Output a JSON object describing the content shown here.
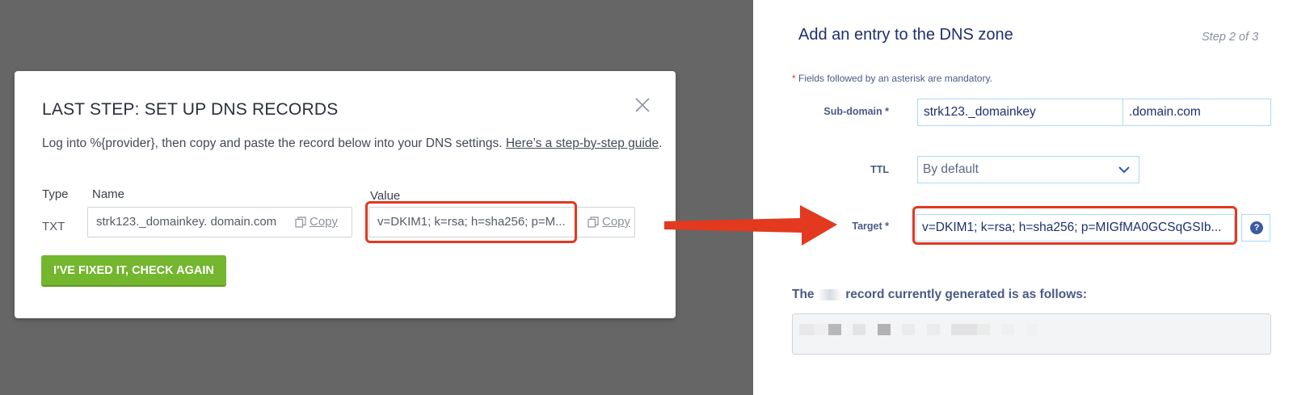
{
  "modal": {
    "title": "LAST STEP: SET UP DNS RECORDS",
    "description_text": "Log into %{provider}, then copy and paste the record below into your DNS settings. ",
    "description_link": "Here’s a step-by-step guide",
    "description_end": ".",
    "columns": {
      "type": "Type",
      "name": "Name",
      "value": "Value"
    },
    "record": {
      "type": "TXT",
      "name": "strk123._domainkey. domain.com",
      "value": "v=DKIM1; k=rsa; h=sha256; p=M...",
      "copy_label": "Copy"
    },
    "check_button": "I'VE FIXED IT, CHECK AGAIN"
  },
  "dns_form": {
    "title": "Add an entry to the DNS zone",
    "step": "Step 2 of 3",
    "mandatory_note_star": "*",
    "mandatory_note": " Fields followed by an asterisk are mandatory.",
    "subdomain_label": "Sub-domain",
    "subdomain_value": "strk123._domainkey",
    "domain_suffix": ".domain.com",
    "ttl_label": "TTL",
    "ttl_value": "By default",
    "target_label": "Target",
    "target_value": "v=DKIM1; k=rsa; h=sha256; p=MIGfMA0GCSqGSIb...",
    "asterisk": "*",
    "generated_prefix": "The ",
    "generated_suffix": "record currently generated is as follows:"
  },
  "colors": {
    "highlight_red": "#e2391f",
    "button_green": "#74b62e",
    "form_blue": "#1f2f6e",
    "input_border": "#a9dcf2"
  },
  "icons": [
    "close-icon",
    "copy-icon",
    "chevron-down-icon",
    "help-icon",
    "arrow-icon"
  ]
}
